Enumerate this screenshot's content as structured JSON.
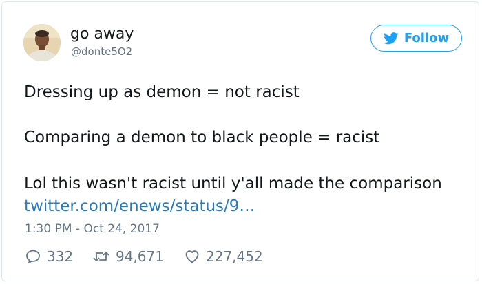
{
  "user": {
    "display_name": "go away",
    "handle": "@donte5O2"
  },
  "follow_button": {
    "label": "Follow"
  },
  "tweet": {
    "lines": [
      "Dressing up as demon = not racist",
      "Comparing a demon to black people = racist",
      "Lol this wasn't racist until y'all made the comparison"
    ],
    "link": "twitter.com/enews/status/9…",
    "timestamp": "1:30 PM - Oct 24, 2017"
  },
  "actions": {
    "replies": "332",
    "retweets": "94,671",
    "likes": "227,452"
  },
  "colors": {
    "accent": "#1da1f2",
    "link": "#2b7bb9",
    "text": "#14171a",
    "muted": "#657786",
    "border": "#e1e8ed"
  },
  "icons": {
    "follow": "twitter-bird-icon",
    "reply": "reply-icon",
    "retweet": "retweet-icon",
    "like": "heart-icon"
  }
}
